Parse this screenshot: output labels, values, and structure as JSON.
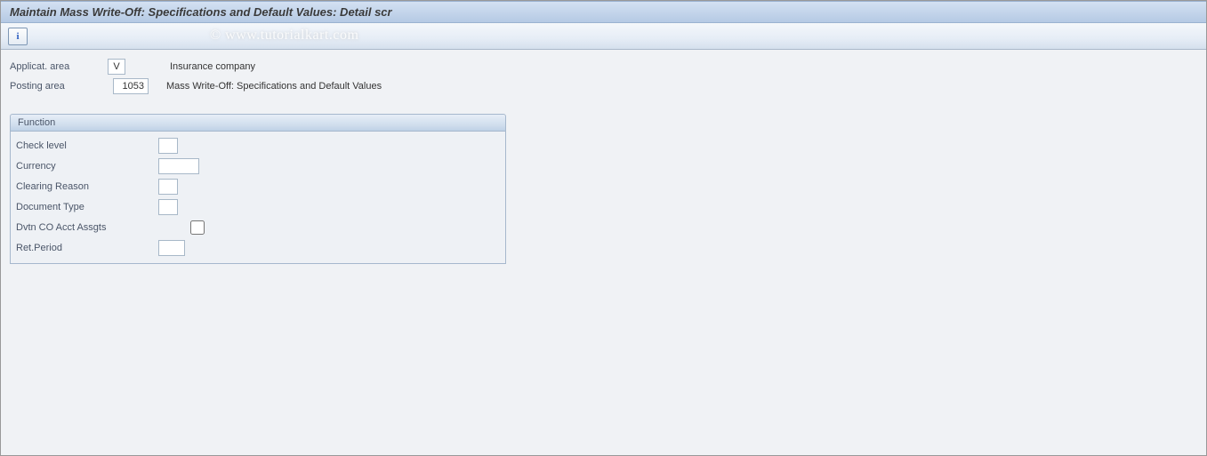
{
  "title": "Maintain Mass Write-Off: Specifications and Default Values: Detail scr",
  "toolbar": {
    "info_icon_text": "i"
  },
  "header": {
    "applicat_area_label": "Applicat. area",
    "applicat_area_value": "V",
    "applicat_area_desc": "Insurance company",
    "posting_area_label": "Posting area",
    "posting_area_value": "1053",
    "posting_area_desc": "Mass Write-Off: Specifications and Default Values"
  },
  "panel": {
    "title": "Function",
    "fields": {
      "check_level": {
        "label": "Check level",
        "value": ""
      },
      "currency": {
        "label": "Currency",
        "value": ""
      },
      "clearing_reason": {
        "label": "Clearing Reason",
        "value": ""
      },
      "document_type": {
        "label": "Document Type",
        "value": ""
      },
      "dvtn_co_acct": {
        "label": "Dvtn CO Acct Assgts",
        "value": ""
      },
      "ret_period": {
        "label": "Ret.Period",
        "value": ""
      }
    }
  },
  "watermark": "© www.tutorialkart.com"
}
